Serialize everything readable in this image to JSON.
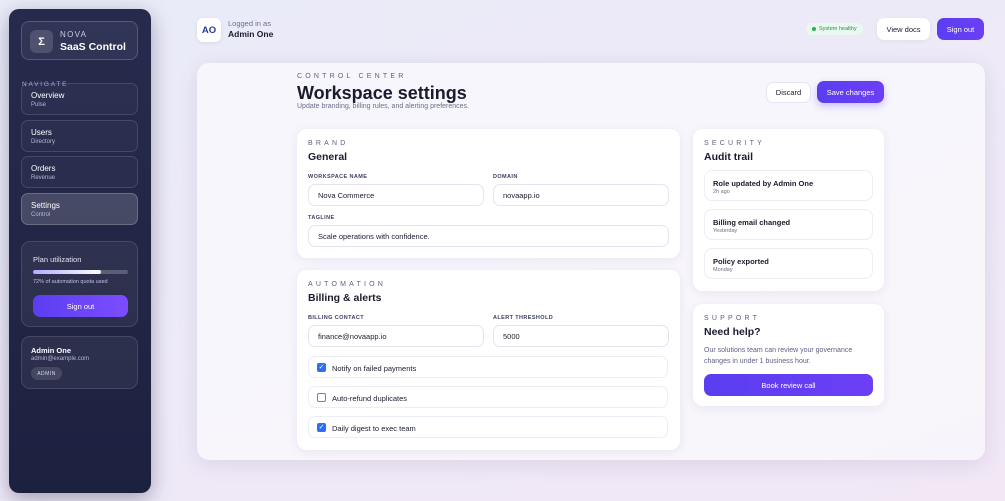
{
  "sidebar": {
    "brand": {
      "icon": "sigma-icon",
      "glyph": "Σ",
      "small": "NOVA",
      "name": "SaaS Control"
    },
    "nav_heading": "NAVIGATE",
    "items": [
      {
        "label": "Overview",
        "sub": "Pulse",
        "active": false
      },
      {
        "label": "Users",
        "sub": "Directory",
        "active": false
      },
      {
        "label": "Orders",
        "sub": "Revenue",
        "active": false
      },
      {
        "label": "Settings",
        "sub": "Control",
        "active": true
      }
    ],
    "plan": {
      "title": "Plan utilization",
      "usage_percent": 72,
      "note": "72% of automation quota used",
      "signout_label": "Sign out"
    },
    "user": {
      "name": "Admin One",
      "email": "admin@example.com",
      "role": "ADMIN"
    }
  },
  "topbar": {
    "avatar": "AO",
    "login_label": "Logged in as",
    "login_name": "Admin One",
    "status": "System healthy",
    "docs_label": "View docs",
    "signout_label": "Sign out"
  },
  "page": {
    "eyebrow": "CONTROL CENTER",
    "title": "Workspace settings",
    "description": "Update branding, billing rules, and alerting preferences.",
    "discard_label": "Discard",
    "save_label": "Save changes"
  },
  "brand_card": {
    "eyebrow": "BRAND",
    "title": "General",
    "workspace_label": "WORKSPACE NAME",
    "workspace_value": "Nova Commerce",
    "domain_label": "DOMAIN",
    "domain_value": "novaapp.io",
    "tagline_label": "TAGLINE",
    "tagline_value": "Scale operations with confidence."
  },
  "automation_card": {
    "eyebrow": "AUTOMATION",
    "title": "Billing & alerts",
    "contact_label": "BILLING CONTACT",
    "contact_value": "finance@novaapp.io",
    "threshold_label": "ALERT THRESHOLD",
    "threshold_value": "5000",
    "options": [
      {
        "label": "Notify on failed payments",
        "checked": true
      },
      {
        "label": "Auto-refund duplicates",
        "checked": false
      },
      {
        "label": "Daily digest to exec team",
        "checked": true
      }
    ]
  },
  "security_card": {
    "eyebrow": "SECURITY",
    "title": "Audit trail",
    "items": [
      {
        "title": "Role updated by Admin One",
        "time": "2h ago"
      },
      {
        "title": "Billing email changed",
        "time": "Yesterday"
      },
      {
        "title": "Policy exported",
        "time": "Monday"
      }
    ]
  },
  "support_card": {
    "eyebrow": "SUPPORT",
    "title": "Need help?",
    "text": "Our solutions team can review your governance changes in under 1 business hour.",
    "button_label": "Book review call"
  }
}
